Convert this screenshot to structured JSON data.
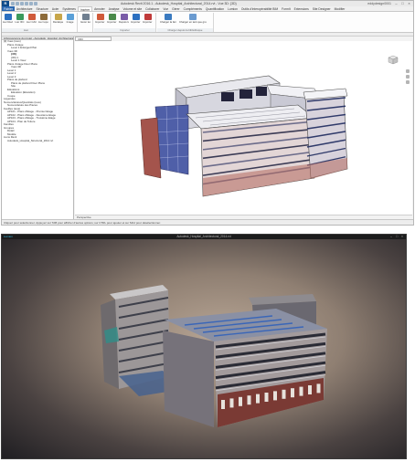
{
  "revit": {
    "app_button": "R",
    "window_title": "Autodesk Revit 2016.1 - Autodesk_Hospital_Architectural_2014.rvt - Vue 3D: {3D}",
    "signin": "eddydesign0001",
    "window_controls": [
      "–",
      "□",
      "×"
    ],
    "tabs": [
      "Fichier",
      "Architecture",
      "Structure",
      "Acier",
      "Systèmes",
      "Insérer",
      "Annoter",
      "Analyse",
      "Volume et site",
      "Collaborer",
      "Vue",
      "Gérer",
      "Compléments",
      "Quantification",
      "Lumion",
      "Outils d'interopérabilité BIM",
      "FormIt",
      "Extensions",
      "Site Designer",
      "Modifier"
    ],
    "active_tab": "Insérer",
    "ribbon": {
      "groups": [
        {
          "label": "Lien",
          "buttons": [
            "Lier Revit",
            "Lier IFC",
            "Lier CAO",
            "Lier topographie"
          ]
        },
        {
          "label": "",
          "buttons": [
            "Décalque",
            "Image"
          ]
        },
        {
          "label": "",
          "buttons": [
            "Gérer les liens"
          ]
        },
        {
          "label": "Importer",
          "buttons": [
            "Importer CAO",
            "Importer gbXML",
            "Depuis la bibliothèque",
            "Importer des familles",
            "Importer PDF"
          ]
        },
        {
          "label": "",
          "buttons": [
            "Charger la famille",
            "Charger en tant que groupe"
          ]
        },
        {
          "label": "Charger depuis la bibliothèque",
          "buttons": []
        }
      ]
    },
    "project_browser": {
      "title": "Arborescence du projet - Autodesk_Hospital_Architectural_2014",
      "nodes": [
        {
          "label": "[0] Vues (tous)",
          "level": 0
        },
        {
          "label": "Plans d'étage",
          "level": 1
        },
        {
          "label": "Level 1 Enlarged Plan",
          "level": 2
        },
        {
          "label": "Vues 3D",
          "level": 1
        },
        {
          "label": "{3D}",
          "level": 2,
          "bold": true
        },
        {
          "label": "{3D} 1",
          "level": 2
        },
        {
          "label": "Level 1 View",
          "level": 2
        },
        {
          "label": "Plans d'étage Floor Plans",
          "level": 1
        },
        {
          "label": "Vues 3D",
          "level": 2
        },
        {
          "label": "Level 1",
          "level": 1
        },
        {
          "label": "Level 2",
          "level": 1
        },
        {
          "label": "Level 3",
          "level": 1
        },
        {
          "label": "Plans de plafond",
          "level": 1
        },
        {
          "label": "Plans de plafond Floor Plans",
          "level": 2
        },
        {
          "label": "Site",
          "level": 2
        },
        {
          "label": "Élévations",
          "level": 1
        },
        {
          "label": "Élévation (Élévation)",
          "level": 2
        },
        {
          "label": "Coupe",
          "level": 1
        },
        {
          "label": "Légendes",
          "level": 0
        },
        {
          "label": "Nomenclatures/Quantités (tous)",
          "level": 0
        },
        {
          "label": "Nomenclature des Pièces",
          "level": 1
        },
        {
          "label": "Feuilles (tous)",
          "level": 0
        },
        {
          "label": "AP101 - Plans d'Étage - Premier Étage",
          "level": 1
        },
        {
          "label": "AP102 - Plans d'Étage - Deuxième Étage",
          "level": 1
        },
        {
          "label": "AP103 - Plans d'Étage - Troisième Étage",
          "level": 1
        },
        {
          "label": "AP104 - Plan de Toiture",
          "level": 1
        },
        {
          "label": "Familles",
          "level": 0
        },
        {
          "label": "Groupes",
          "level": 0
        },
        {
          "label": "Détail",
          "level": 1
        },
        {
          "label": "Modèle",
          "level": 1
        },
        {
          "label": "Liens Revit",
          "level": 0
        },
        {
          "label": "Autodesk_Hospital_Structural_2014.rvt",
          "level": 1
        }
      ]
    },
    "view_tab": "{3D}",
    "view_controls": "Perspective",
    "status_bar": "Cliquez pour sélectionner. Appuyez sur TAB pour afficher d'autres options; sur CTRL pour ajouter et sur MAJ pour désélectionner."
  },
  "viewer": {
    "app_name": "Lumion",
    "title": "Autodesk_Hospital_Architectural_2014.rvt",
    "window_controls": [
      "–",
      "□",
      "×"
    ]
  },
  "colors": {
    "revit_app": "#0e4a8a",
    "viewer_accent": "#35c6f0",
    "brick": "#a4544c",
    "glass": "#4f5fa8"
  }
}
